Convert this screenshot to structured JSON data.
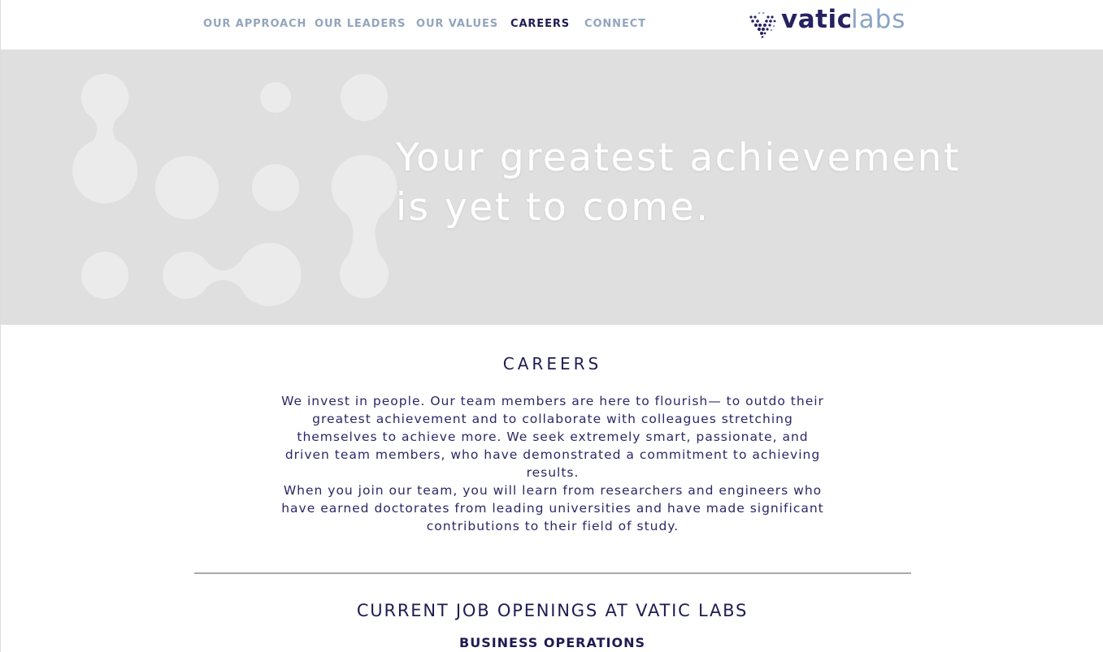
{
  "nav": {
    "items": [
      {
        "label": "OUR APPROACH",
        "active": false
      },
      {
        "label": "OUR LEADERS",
        "active": false
      },
      {
        "label": "OUR VALUES",
        "active": false
      },
      {
        "label": "CAREERS",
        "active": true
      },
      {
        "label": "CONNECT",
        "active": false
      }
    ],
    "logo": {
      "word1": "vatic",
      "word2": "labs",
      "icon": "dot-matrix-v-logo-icon"
    }
  },
  "hero": {
    "title": "Your greatest achievement is yet to come.",
    "art": "molecule-dots-graphic"
  },
  "careers": {
    "heading": "CAREERS",
    "paragraph_1": "We invest in people. Our team members are here to flourish— to outdo their greatest achievement and to collaborate with colleagues stretching themselves to achieve more. We seek extremely smart, passionate, and driven team members, who have demonstrated a commitment to achieving results.",
    "paragraph_2": "When you join our team, you will learn from researchers and engineers who have earned doctorates from leading universities and have made significant contributions to their field of study."
  },
  "openings": {
    "heading": "CURRENT JOB OPENINGS AT VATIC LABS",
    "departments": [
      "BUSINESS OPERATIONS"
    ]
  },
  "colors": {
    "navy": "#1f1c52",
    "nav_inactive": "#93a5bd",
    "hero_bg": "#e0dfdf",
    "logo_light": "#8ba4c4"
  }
}
